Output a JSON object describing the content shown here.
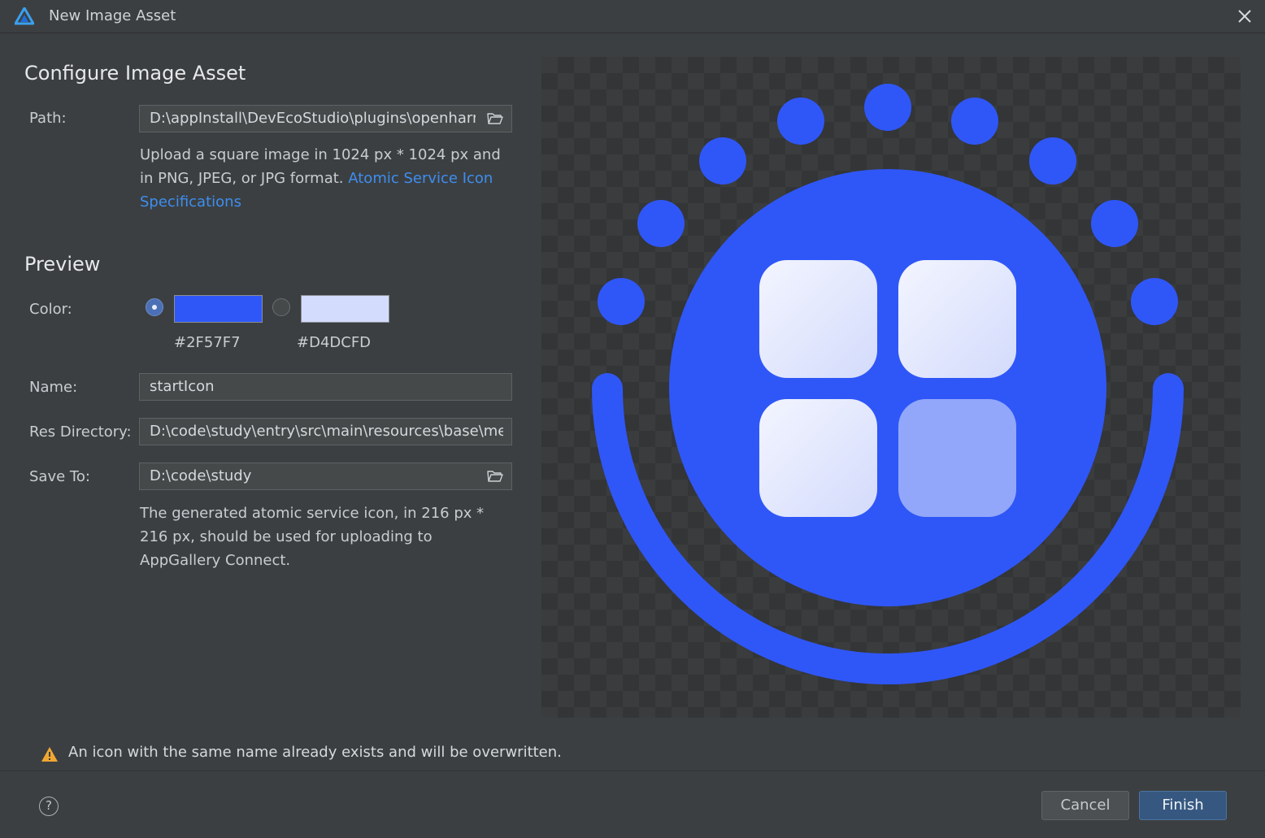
{
  "window": {
    "title": "New Image Asset",
    "icon": "deveco-logo-icon"
  },
  "configure": {
    "heading": "Configure Image Asset",
    "path_label": "Path:",
    "path_value": "D:\\appInstall\\DevEcoStudio\\plugins\\openharmony",
    "help_text": "Upload a square image in 1024 px * 1024 px and in PNG, JPEG, or JPG format. ",
    "help_link": "Atomic Service Icon Specifications"
  },
  "preview": {
    "heading": "Preview",
    "color_label": "Color:",
    "colors": [
      {
        "hex": "#2F57F7",
        "selected": true
      },
      {
        "hex": "#D4DCFD",
        "selected": false
      }
    ]
  },
  "output": {
    "name_label": "Name:",
    "name_value": "startIcon",
    "resdir_label": "Res Directory:",
    "resdir_value": "D:\\code\\study\\entry\\src\\main\\resources\\base\\media",
    "saveto_label": "Save To:",
    "saveto_value": "D:\\code\\study",
    "note": "The generated atomic service icon, in 216 px * 216 px, should be used for uploading to AppGallery Connect."
  },
  "warning": {
    "text": "An icon with the same name already exists and will be overwritten.",
    "color": "#F0A732"
  },
  "footer": {
    "help": "?",
    "cancel": "Cancel",
    "finish": "Finish"
  },
  "theme": {
    "background": "#3C3F41",
    "accent": "#2F57F7",
    "tile_light": "#D4DCFD",
    "link": "#3D8EF0"
  }
}
